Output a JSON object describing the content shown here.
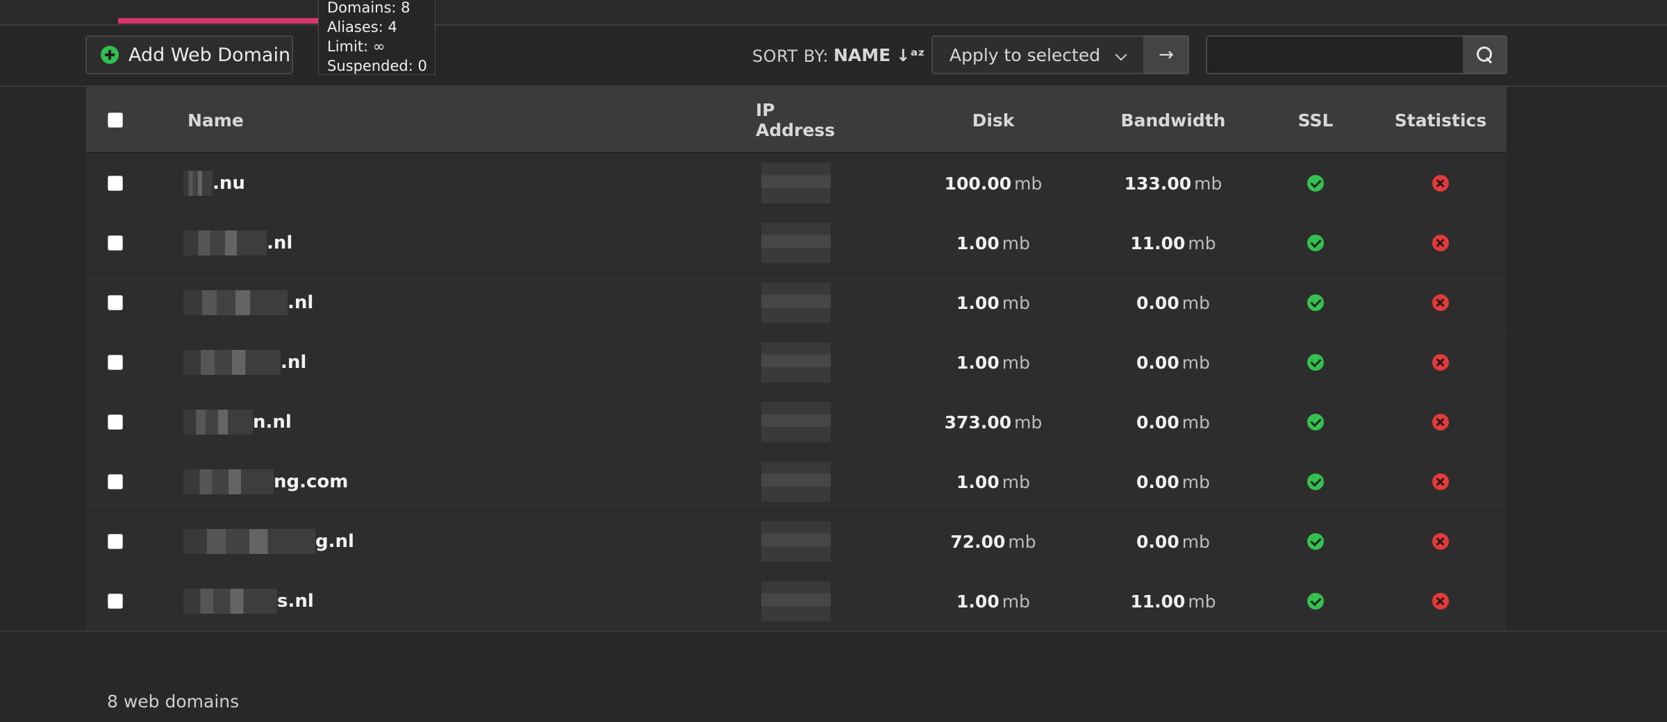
{
  "tooltip": {
    "domains": "Domains: 8",
    "aliases": "Aliases: 4",
    "limit": "Limit: ∞",
    "suspended": "Suspended: 0"
  },
  "toolbar": {
    "add_label": "Add Web Domain",
    "sort_by_label": "SORT BY:",
    "sort_value": "NAME",
    "sort_icon": "↓a̲z",
    "apply_label": "Apply to selected",
    "apply_go": "→",
    "search_placeholder": ""
  },
  "table": {
    "headers": {
      "name": "Name",
      "ip": "IP Address",
      "disk": "Disk",
      "bandwidth": "Bandwidth",
      "ssl": "SSL",
      "stats": "Statistics"
    },
    "rows": [
      {
        "name": ".nu",
        "disk": "100.00",
        "bandwidth": "133.00",
        "unit": "mb",
        "ssl": "enabled",
        "stats": "disabled"
      },
      {
        "name": ".nl",
        "disk": "1.00",
        "bandwidth": "11.00",
        "unit": "mb",
        "ssl": "enabled",
        "stats": "disabled"
      },
      {
        "name": ".nl",
        "disk": "1.00",
        "bandwidth": "0.00",
        "unit": "mb",
        "ssl": "enabled",
        "stats": "disabled"
      },
      {
        "name": ".nl",
        "disk": "1.00",
        "bandwidth": "0.00",
        "unit": "mb",
        "ssl": "enabled",
        "stats": "disabled"
      },
      {
        "name": "n.nl",
        "disk": "373.00",
        "bandwidth": "0.00",
        "unit": "mb",
        "ssl": "enabled",
        "stats": "disabled"
      },
      {
        "name": "ng.com",
        "disk": "1.00",
        "bandwidth": "0.00",
        "unit": "mb",
        "ssl": "enabled",
        "stats": "disabled"
      },
      {
        "name": "g.nl",
        "disk": "72.00",
        "bandwidth": "0.00",
        "unit": "mb",
        "ssl": "enabled",
        "stats": "disabled"
      },
      {
        "name": "s.nl",
        "disk": "1.00",
        "bandwidth": "11.00",
        "unit": "mb",
        "ssl": "enabled",
        "stats": "disabled"
      }
    ]
  },
  "footer": {
    "count_label": "8 web domains"
  },
  "colors": {
    "accent": "#d7376c",
    "ok": "#35c150",
    "error": "#e33b3b"
  }
}
